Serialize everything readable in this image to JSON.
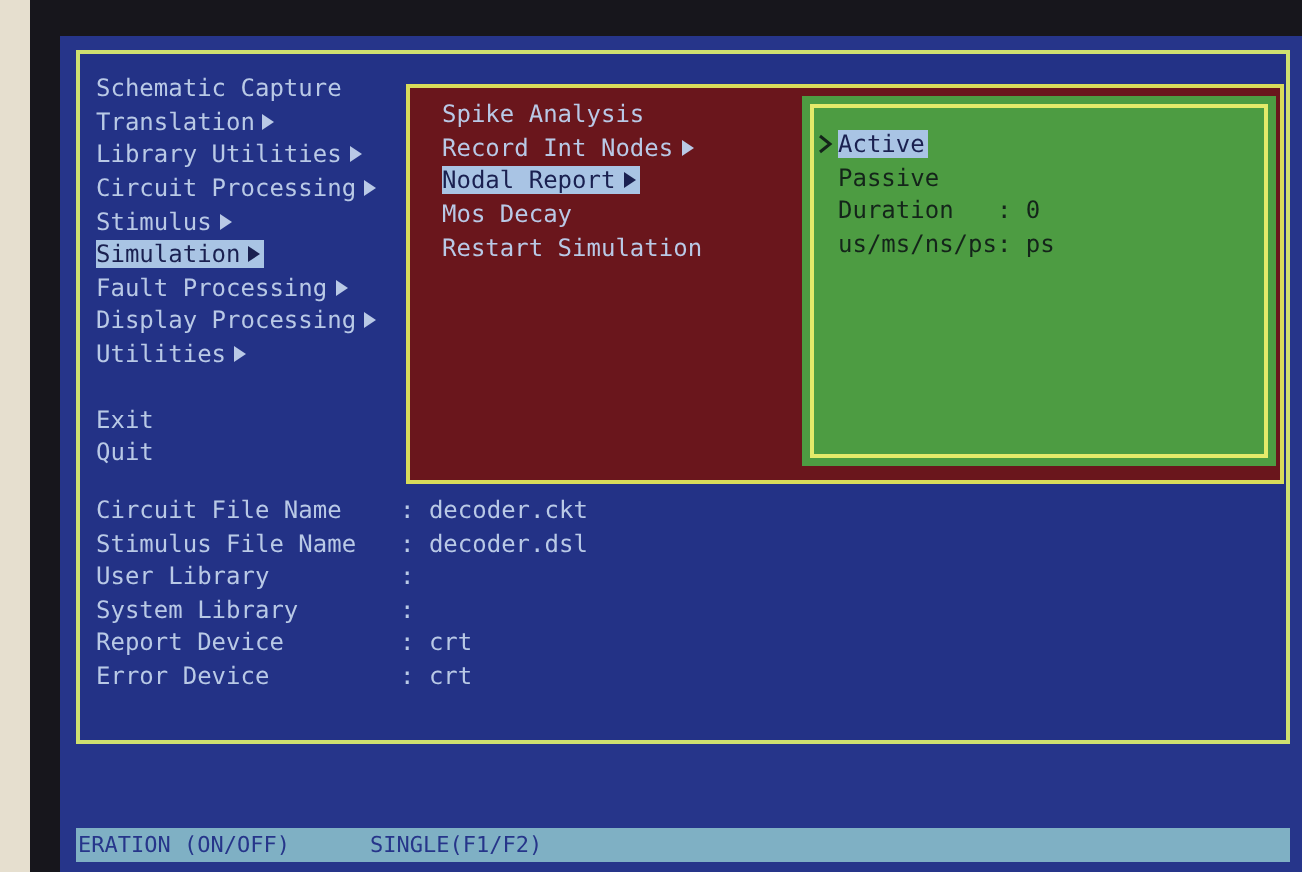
{
  "main_menu": [
    {
      "label": "Schematic Capture",
      "submenu": false,
      "selected": false
    },
    {
      "label": "Translation",
      "submenu": true,
      "selected": false
    },
    {
      "label": "Library Utilities",
      "submenu": true,
      "selected": false
    },
    {
      "label": "Circuit Processing",
      "submenu": true,
      "selected": false
    },
    {
      "label": "Stimulus",
      "submenu": true,
      "selected": false
    },
    {
      "label": "Simulation",
      "submenu": true,
      "selected": true
    },
    {
      "label": "Fault Processing",
      "submenu": true,
      "selected": false
    },
    {
      "label": "Display Processing",
      "submenu": true,
      "selected": false
    },
    {
      "label": "Utilities",
      "submenu": true,
      "selected": false
    }
  ],
  "exit_menu": [
    {
      "label": "Exit",
      "selected": false
    },
    {
      "label": "Quit",
      "selected": false
    }
  ],
  "simulation_menu": [
    {
      "label": "Spike Analysis",
      "submenu": false,
      "selected": false
    },
    {
      "label": "Record Int Nodes",
      "submenu": true,
      "selected": false
    },
    {
      "label": "Nodal Report",
      "submenu": true,
      "selected": true
    },
    {
      "label": "Mos Decay",
      "submenu": false,
      "selected": false
    },
    {
      "label": "Restart Simulation",
      "submenu": false,
      "selected": false
    }
  ],
  "nodal_report_menu": [
    {
      "label": "Active",
      "selected": true
    },
    {
      "label": "Passive",
      "selected": false
    },
    {
      "label": "Duration   : 0",
      "selected": false
    },
    {
      "label": "us/ms/ns/ps: ps",
      "selected": false
    }
  ],
  "settings": [
    {
      "label": "Circuit File Name",
      "value": ": decoder.ckt"
    },
    {
      "label": "Stimulus File Name",
      "value": ": decoder.dsl"
    },
    {
      "label": "User Library",
      "value": ":"
    },
    {
      "label": "System Library",
      "value": ":"
    },
    {
      "label": "Report Device",
      "value": ": crt"
    },
    {
      "label": "Error Device",
      "value": ": crt"
    }
  ],
  "status_bar": [
    "ERATION (ON/OFF)",
    "SINGLE(F1/F2)"
  ]
}
